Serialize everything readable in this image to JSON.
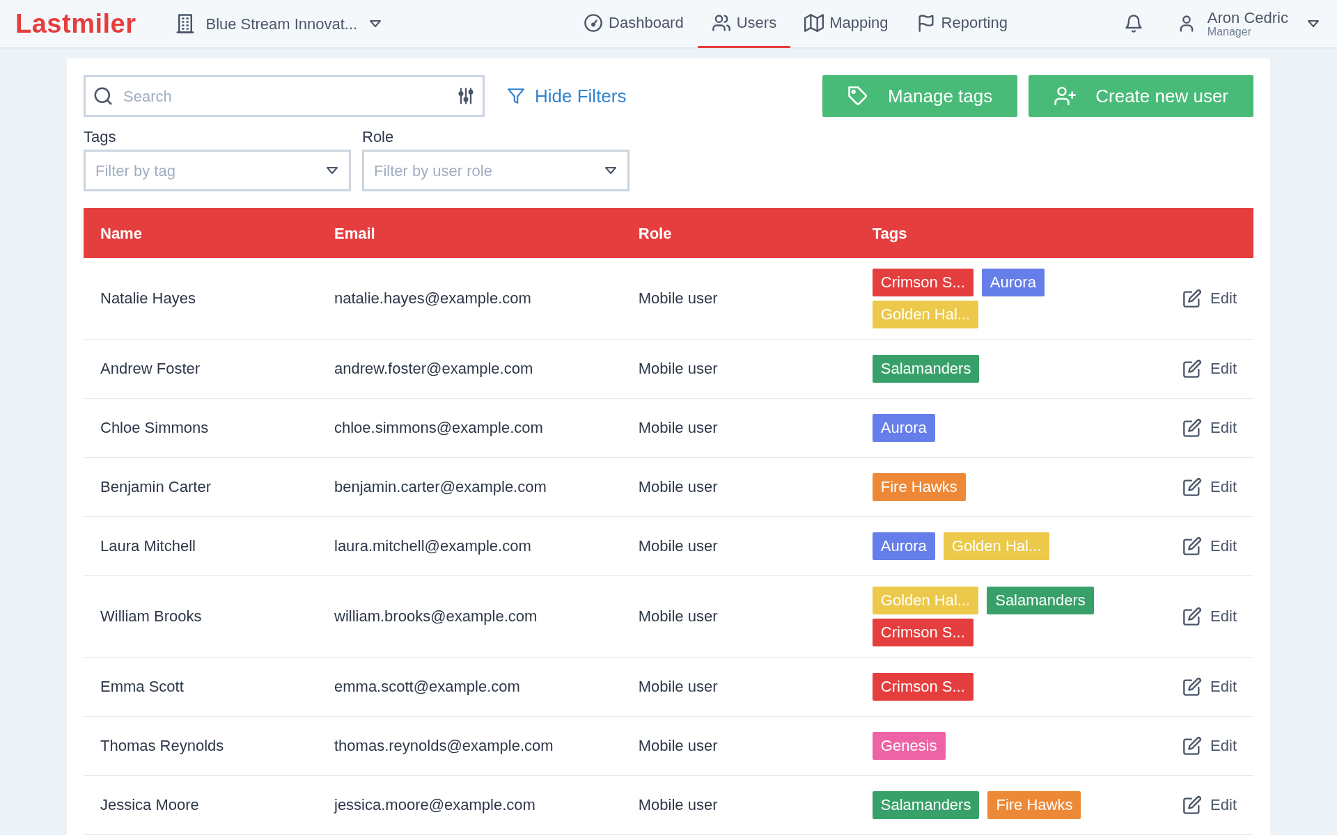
{
  "header": {
    "logo": "Lastmiler",
    "organization": "Blue Stream Innovat...",
    "nav": [
      {
        "label": "Dashboard",
        "selected": false
      },
      {
        "label": "Users",
        "selected": true
      },
      {
        "label": "Mapping",
        "selected": false
      },
      {
        "label": "Reporting",
        "selected": false
      }
    ],
    "user": {
      "name": "Aron Cedric",
      "role": "Manager"
    }
  },
  "toolbar": {
    "search_placeholder": "Search",
    "hide_filters": "Hide Filters",
    "manage_tags": "Manage tags",
    "create_user": "Create new user"
  },
  "filters": [
    {
      "label": "Tags",
      "placeholder": "Filter by tag"
    },
    {
      "label": "Role",
      "placeholder": "Filter by user role"
    }
  ],
  "table": {
    "columns": [
      "Name",
      "Email",
      "Role",
      "Tags"
    ],
    "rows": [
      {
        "name": "Natalie Hayes",
        "email": "natalie.hayes@example.com",
        "role": "Mobile user",
        "tags": [
          {
            "label": "Crimson S...",
            "color": "#e53e3e"
          },
          {
            "label": "Aurora",
            "color": "#667eea"
          },
          {
            "label": "Golden Hal...",
            "color": "#ecc94b"
          }
        ],
        "action": "Edit"
      },
      {
        "name": "Andrew Foster",
        "email": "andrew.foster@example.com",
        "role": "Mobile user",
        "tags": [
          {
            "label": "Salamanders",
            "color": "#38a169"
          }
        ],
        "action": "Edit"
      },
      {
        "name": "Chloe Simmons",
        "email": "chloe.simmons@example.com",
        "role": "Mobile user",
        "tags": [
          {
            "label": "Aurora",
            "color": "#667eea"
          }
        ],
        "action": "Edit"
      },
      {
        "name": "Benjamin Carter",
        "email": "benjamin.carter@example.com",
        "role": "Mobile user",
        "tags": [
          {
            "label": "Fire Hawks",
            "color": "#ed8936"
          }
        ],
        "action": "Edit"
      },
      {
        "name": "Laura Mitchell",
        "email": "laura.mitchell@example.com",
        "role": "Mobile user",
        "tags": [
          {
            "label": "Aurora",
            "color": "#667eea"
          },
          {
            "label": "Golden Hal...",
            "color": "#ecc94b"
          }
        ],
        "action": "Edit"
      },
      {
        "name": "William Brooks",
        "email": "william.brooks@example.com",
        "role": "Mobile user",
        "tags": [
          {
            "label": "Golden Hal...",
            "color": "#ecc94b"
          },
          {
            "label": "Salamanders",
            "color": "#38a169"
          },
          {
            "label": "Crimson S...",
            "color": "#e53e3e"
          }
        ],
        "action": "Edit"
      },
      {
        "name": "Emma Scott",
        "email": "emma.scott@example.com",
        "role": "Mobile user",
        "tags": [
          {
            "label": "Crimson S...",
            "color": "#e53e3e"
          }
        ],
        "action": "Edit"
      },
      {
        "name": "Thomas Reynolds",
        "email": "thomas.reynolds@example.com",
        "role": "Mobile user",
        "tags": [
          {
            "label": "Genesis",
            "color": "#ed64a6"
          }
        ],
        "action": "Edit"
      },
      {
        "name": "Jessica Moore",
        "email": "jessica.moore@example.com",
        "role": "Mobile user",
        "tags": [
          {
            "label": "Salamanders",
            "color": "#38a169"
          },
          {
            "label": "Fire Hawks",
            "color": "#ed8936"
          }
        ],
        "action": "Edit"
      }
    ]
  }
}
